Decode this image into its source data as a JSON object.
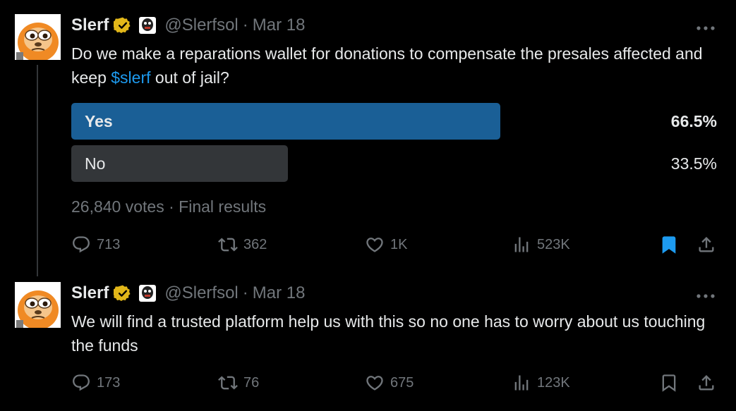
{
  "tweets": [
    {
      "name": "Slerf",
      "handle": "@Slerfsol",
      "separator": "·",
      "date": "Mar 18",
      "text_before": "Do we make a reparations wallet for donations to compensate the presales affected and keep ",
      "cashtag": "$slerf",
      "text_after": " out of jail?",
      "poll": {
        "options": [
          {
            "label": "Yes",
            "percent_text": "66.5%",
            "percent": 66.5,
            "winner": true,
            "color": "#1a5f96"
          },
          {
            "label": "No",
            "percent_text": "33.5%",
            "percent": 33.5,
            "winner": false,
            "color": "#333639"
          }
        ],
        "votes": "26,840 votes",
        "separator": "·",
        "status": "Final results"
      },
      "stats": {
        "replies": "713",
        "retweets": "362",
        "likes": "1K",
        "views": "523K"
      },
      "bookmarked": true
    },
    {
      "name": "Slerf",
      "handle": "@Slerfsol",
      "separator": "·",
      "date": "Mar 18",
      "text": "We will find a trusted platform help us with this so no one has to worry about us touching the funds",
      "stats": {
        "replies": "173",
        "retweets": "76",
        "likes": "675",
        "views": "123K"
      },
      "bookmarked": false
    }
  ],
  "colors": {
    "accent": "#1d9bf0",
    "muted": "#71767b",
    "verified_gold": "#e2b719"
  },
  "icons": [
    "more-icon",
    "verified-badge-icon",
    "affiliate-badge-icon",
    "reply-icon",
    "retweet-icon",
    "like-icon",
    "views-icon",
    "bookmark-icon",
    "share-icon"
  ]
}
